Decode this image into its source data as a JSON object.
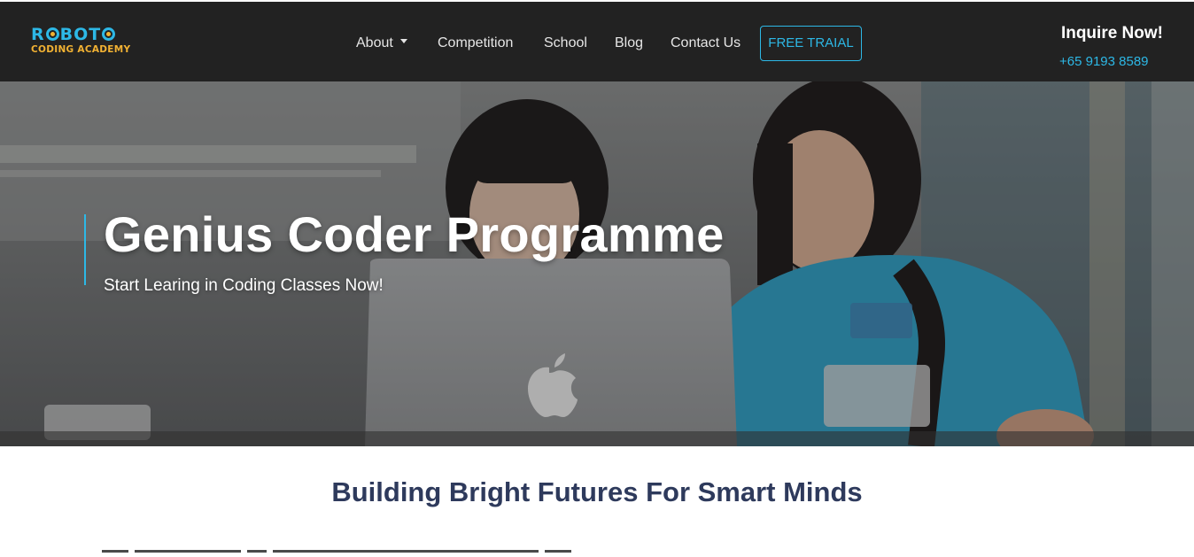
{
  "brand": {
    "logo_top": "ROBOTO",
    "logo_bottom": "CODING ACADEMY"
  },
  "nav": {
    "items": [
      "About",
      "Competition",
      "School",
      "Blog",
      "Contact Us"
    ],
    "cta": "FREE TRAIAL"
  },
  "contact": {
    "heading": "Inquire Now!",
    "phone": "+65 9193 8589"
  },
  "hero": {
    "title": "Genius Coder Programme",
    "subtitle": "Start Learing in Coding Classes Now!",
    "image_icon": "apple-logo-icon"
  },
  "section": {
    "title": "Building Bright Futures For Smart Minds"
  },
  "colors": {
    "accent": "#2db8e6",
    "logo_gold": "#f2b233",
    "nav_bg": "#222222",
    "heading": "#2e3a5c"
  }
}
